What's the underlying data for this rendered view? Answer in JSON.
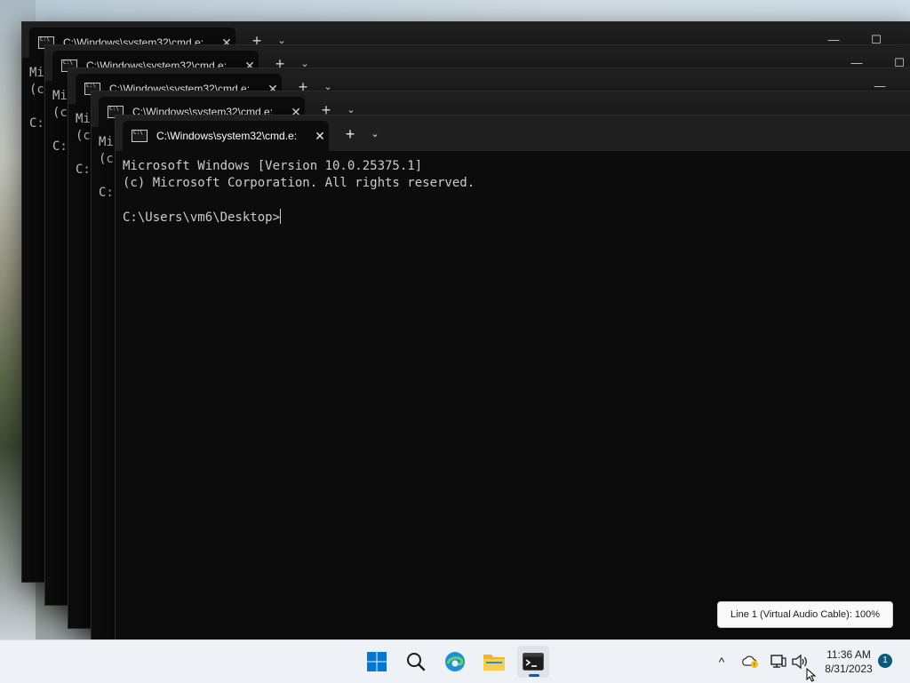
{
  "windows": [
    {
      "tab_title": "C:\\Windows\\system32\\cmd.e:",
      "lines": [
        "Mi",
        "(c",
        "",
        "C:"
      ]
    },
    {
      "tab_title": "C:\\Windows\\system32\\cmd.e:",
      "lines": [
        "Mi",
        "(c",
        "",
        "C:"
      ]
    },
    {
      "tab_title": "C:\\Windows\\system32\\cmd.e:",
      "lines": [
        "Mi",
        "(c",
        "",
        "C:"
      ]
    },
    {
      "tab_title": "C:\\Windows\\system32\\cmd.e:",
      "lines": [
        "Mi",
        "(c",
        "",
        "C:"
      ]
    },
    {
      "tab_title": "C:\\Windows\\system32\\cmd.e:",
      "lines": [
        "Microsoft Windows [Version 10.0.25375.1]",
        "(c) Microsoft Corporation. All rights reserved.",
        "",
        "C:\\Users\\vm6\\Desktop>"
      ]
    }
  ],
  "tab_controls": {
    "close": "✕",
    "new_tab": "+",
    "dropdown": "⌄"
  },
  "window_controls": {
    "minimize": "—",
    "maximize": "☐"
  },
  "taskbar": {
    "apps": [
      {
        "name": "start-button",
        "icon": "windows-logo-icon"
      },
      {
        "name": "search-button",
        "icon": "search-icon"
      },
      {
        "name": "edge-button",
        "icon": "edge-icon"
      },
      {
        "name": "file-explorer-button",
        "icon": "folder-icon"
      },
      {
        "name": "terminal-button",
        "icon": "terminal-icon",
        "active": true
      }
    ],
    "tray": {
      "overflow": "^",
      "clock_time": "11:36 AM",
      "clock_date": "8/31/2023",
      "notification_count": "1"
    }
  },
  "tooltip": "Line 1 (Virtual Audio Cable): 100%",
  "colors": {
    "terminal_bg": "#0c0c0c",
    "titlebar_bg": "#1f1f1f",
    "taskbar_bg": "#eef1f5",
    "accent": "#005fb8"
  }
}
